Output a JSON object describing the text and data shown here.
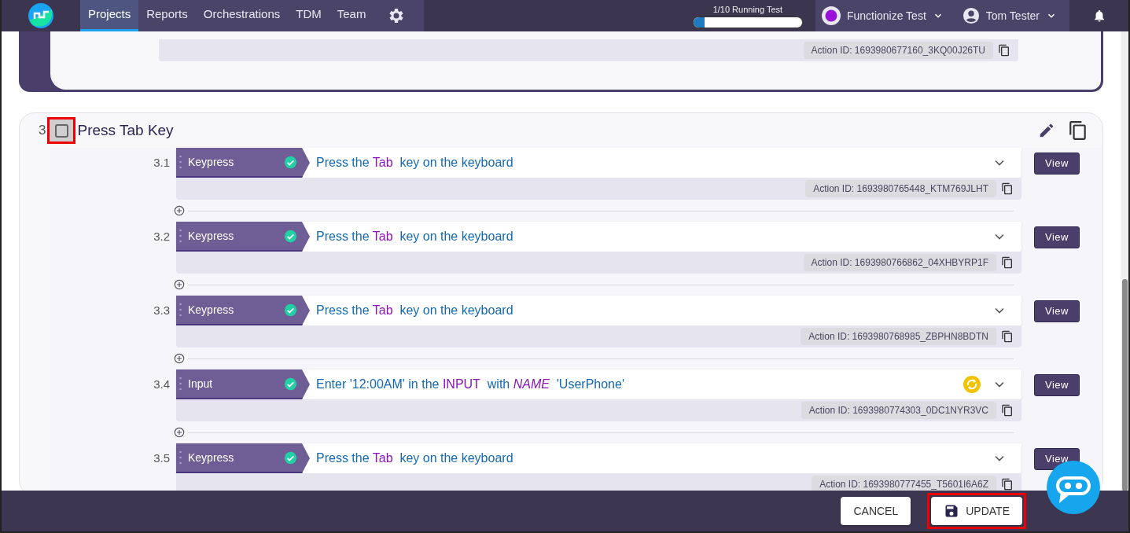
{
  "navbar": {
    "tabs": [
      {
        "label": "Projects",
        "selected": true
      },
      {
        "label": "Reports",
        "selected": false
      },
      {
        "label": "Orchestrations",
        "selected": false
      },
      {
        "label": "TDM",
        "selected": false
      },
      {
        "label": "Team",
        "selected": false
      }
    ],
    "running": {
      "label": "1/10 Running Test",
      "level": 0.1
    },
    "workspace": {
      "label": "Functionize Test"
    },
    "user": {
      "label": "Tom Tester"
    }
  },
  "previous_step": {
    "action_id": "Action ID: 1693980677160_3KQ00J26TU"
  },
  "group": {
    "number": "3",
    "title": "Press Tab Key",
    "checked": false,
    "highlighted": true,
    "steps": [
      {
        "number": "3.1",
        "type_label": "Keypress",
        "passed": true,
        "healed": false,
        "description": [
          {
            "kind": "text",
            "text": "Press the"
          },
          {
            "kind": "keyword",
            "text": "Tab"
          },
          {
            "kind": "text",
            "text": "key on the keyboard"
          }
        ],
        "action_id": "Action ID: 1693980765448_KTM769JLHT",
        "view_label": "View"
      },
      {
        "number": "3.2",
        "type_label": "Keypress",
        "passed": true,
        "healed": false,
        "description": [
          {
            "kind": "text",
            "text": "Press the"
          },
          {
            "kind": "keyword",
            "text": "Tab"
          },
          {
            "kind": "text",
            "text": "key on the keyboard"
          }
        ],
        "action_id": "Action ID: 1693980766862_04XHBYRP1F",
        "view_label": "View"
      },
      {
        "number": "3.3",
        "type_label": "Keypress",
        "passed": true,
        "healed": false,
        "description": [
          {
            "kind": "text",
            "text": "Press the"
          },
          {
            "kind": "keyword",
            "text": "Tab"
          },
          {
            "kind": "text",
            "text": "key on the keyboard"
          }
        ],
        "action_id": "Action ID: 1693980768985_ZBPHN8BDTN",
        "view_label": "View"
      },
      {
        "number": "3.4",
        "type_label": "Input",
        "passed": true,
        "healed": true,
        "description": [
          {
            "kind": "text",
            "text": "Enter '12:00AM' in the"
          },
          {
            "kind": "keyword",
            "text": "INPUT"
          },
          {
            "kind": "text",
            "text": "with"
          },
          {
            "kind": "attribute",
            "text": "NAME"
          },
          {
            "kind": "text",
            "text": "'UserPhone'"
          }
        ],
        "action_id": "Action ID: 1693980774303_0DC1NYR3VC",
        "view_label": "View"
      },
      {
        "number": "3.5",
        "type_label": "Keypress",
        "passed": true,
        "healed": false,
        "description": [
          {
            "kind": "text",
            "text": "Press the"
          },
          {
            "kind": "keyword",
            "text": "Tab"
          },
          {
            "kind": "text",
            "text": "key on the keyboard"
          }
        ],
        "action_id": "Action ID: 1693980777455_T5601I6A6Z",
        "view_label": "View"
      }
    ]
  },
  "footer": {
    "buttons": [
      {
        "kind": "cancel",
        "label": "CANCEL",
        "highlighted": false
      },
      {
        "kind": "save",
        "label": "UPDATE",
        "highlighted": true
      }
    ]
  }
}
